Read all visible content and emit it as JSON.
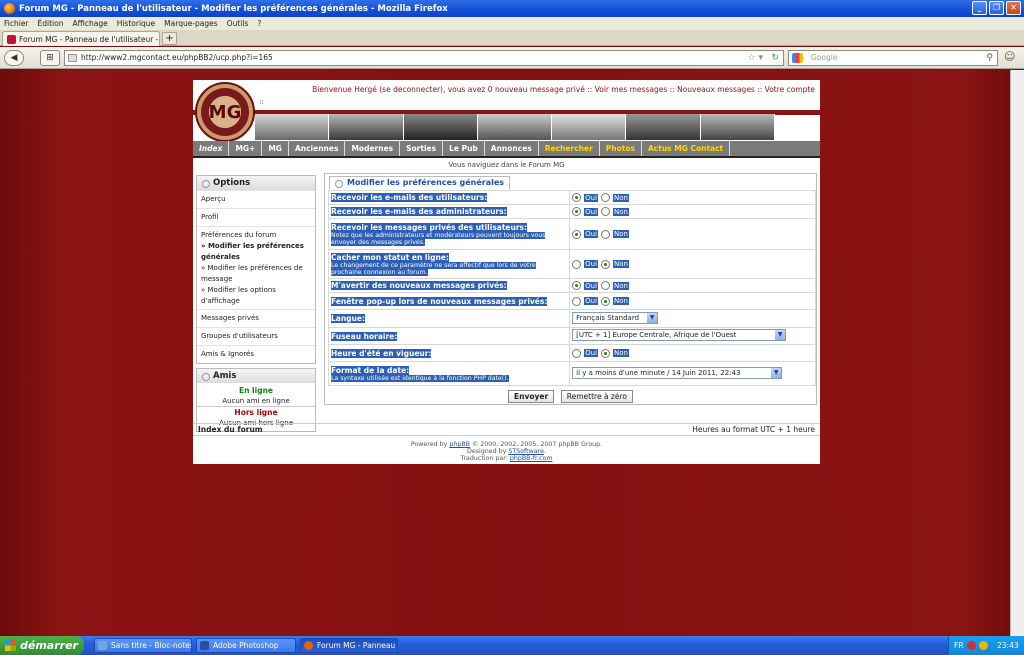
{
  "window": {
    "title": "Forum MG - Panneau de l'utilisateur - Modifier les préférences générales - Mozilla Firefox",
    "controls": [
      "_",
      "❐",
      "✕"
    ]
  },
  "menu": [
    "Fichier",
    "Édition",
    "Affichage",
    "Historique",
    "Marque-pages",
    "Outils",
    "?"
  ],
  "tab": {
    "title": "Forum MG - Panneau de l'utilisateur - Modifie...",
    "new_tab": "+"
  },
  "nav": {
    "url": "http://www2.mgcontact.eu/phpBB2/ucp.php?i=165",
    "search_placeholder": "Google"
  },
  "forum": {
    "logo_text": "MG",
    "logo_sep": "::",
    "welcome": "Bienvenue Hergé (se deconnecter), vous avez 0 nouveau message privé :: Voir mes messages :: Nouveaux messages :: Votre compte",
    "nav_tabs": [
      {
        "label": "Index",
        "style": "italic"
      },
      {
        "label": "MG+",
        "style": ""
      },
      {
        "label": "MG",
        "style": ""
      },
      {
        "label": "Anciennes",
        "style": ""
      },
      {
        "label": "Modernes",
        "style": ""
      },
      {
        "label": "Sorties",
        "style": ""
      },
      {
        "label": "Le Pub",
        "style": ""
      },
      {
        "label": "Annonces",
        "style": ""
      },
      {
        "label": "Rechercher",
        "style": "yellow"
      },
      {
        "label": "Photos",
        "style": "yellow"
      },
      {
        "label": "Actus MG Contact",
        "style": "yellow"
      }
    ],
    "browsing": "Vous naviguez dans le Forum MG"
  },
  "sidebar": {
    "options_title": "Options",
    "apercu": "Aperçu",
    "profil": "Profil",
    "prefs_title": "Préférences du forum",
    "prefs": [
      "» Modifier les préférences générales",
      "» Modifier les préférences de message",
      "» Modifier les options d'affichage"
    ],
    "messages": "Messages privés",
    "groupes": "Groupes d'utilisateurs",
    "amis_ignores": "Amis & Ignorés",
    "amis_title": "Amis",
    "online_title": "En ligne",
    "online_none": "Aucun ami en ligne",
    "offline_title": "Hors ligne",
    "offline_none": "Aucun ami hors ligne"
  },
  "panel": {
    "tab_title": "Modifier les préférences générales",
    "yes": "Oui",
    "no": "Non",
    "rows": [
      {
        "label": "Recevoir les e-mails des utilisateurs:",
        "note": "",
        "value": "yes"
      },
      {
        "label": "Recevoir les e-mails des administrateurs:",
        "note": "",
        "value": "yes"
      },
      {
        "label": "Recevoir les messages privés des utilisateurs:",
        "note": "Notez que les administrateurs et modérateurs peuvent toujours vous envoyer des messages privés.",
        "value": "yes"
      },
      {
        "label": "Cacher mon statut en ligne:",
        "note": "Le changement de ce paramètre ne sera effectif que lors de votre prochaine connexion au forum.",
        "value": "no"
      },
      {
        "label": "M'avertir des nouveaux messages privés:",
        "note": "",
        "value": "yes"
      },
      {
        "label": "Fenêtre pop-up lors de nouveaux messages privés:",
        "note": "",
        "value": "no"
      }
    ],
    "langue_label": "Langue:",
    "langue_value": "Français Standard",
    "fuseau_label": "Fuseau horaire:",
    "fuseau_value": "[UTC + 1] Europe Centrale, Afrique de l'Ouest",
    "dst_label": "Heure d'été en vigueur:",
    "dst_value": "no",
    "date_label": "Format de la date:",
    "date_note": "La syntaxe utilisée est identique à la fonction PHP date().",
    "date_value": "il y a moins d'une minute / 14 Juin 2011, 22:43",
    "submit": "Envoyer",
    "reset": "Remettre à zéro"
  },
  "footer": {
    "index": "Index du forum",
    "timezone": "Heures au format UTC + 1 heure",
    "powered_pre": "Powered by ",
    "phpbb": "phpBB",
    "powered_post": " © 2000, 2002, 2005, 2007 phpBB Group.",
    "designed_pre": "Designed by ",
    "designer": "STSoftware",
    "designed_post": ".",
    "translation_pre": "Traduction par: ",
    "translator": "phpBB-fr.com"
  },
  "taskbar": {
    "start": "démarrer",
    "tasks": [
      {
        "label": "Sans titre - Bloc-notes",
        "color": "#6fa8dc"
      },
      {
        "label": "Adobe Photoshop",
        "color": "#2a4f9a"
      },
      {
        "label": "Forum MG - Panneau ...",
        "color": "#e2620a"
      }
    ],
    "lang": "FR",
    "clock": "23:43"
  }
}
